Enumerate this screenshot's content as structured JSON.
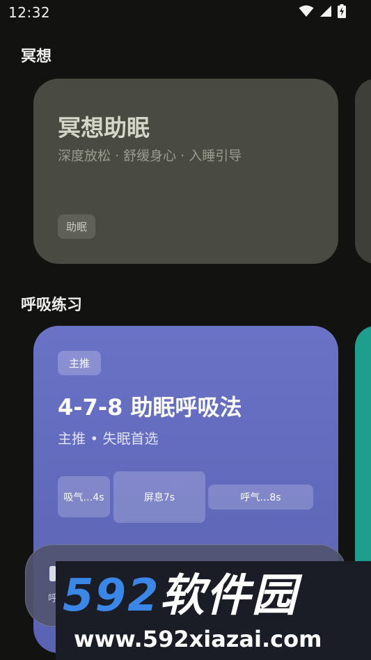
{
  "status_bar": {
    "time": "12:32",
    "icons": [
      "wifi-icon",
      "cellular-signal-icon",
      "battery-charging-icon"
    ]
  },
  "sections": {
    "meditation": "冥想",
    "breathing": "呼吸练习"
  },
  "meditation_card": {
    "title": "冥想助眠",
    "subtitle": "深度放松 · 舒缓身心 · 入睡引导",
    "tag": "助眠"
  },
  "breathing_card": {
    "tag": "主推",
    "title": "4-7-8 助眠呼吸法",
    "subtitle": "主推 • 失眠首选",
    "phases": {
      "inhale": "吸气…4s",
      "hold": "屏息7s",
      "exhale": "呼气…8s"
    }
  },
  "mini_player": {
    "text": "呼"
  },
  "watermark": {
    "digits": "592",
    "brand": "软件园",
    "url": "www.592xiazai.com"
  },
  "colors": {
    "background": "#121211",
    "meditation_card": "#494b43",
    "breathing_card": "#6a72c6",
    "peek_card_teal": "#1e9e8c",
    "watermark_blue": "#3a87e8"
  }
}
